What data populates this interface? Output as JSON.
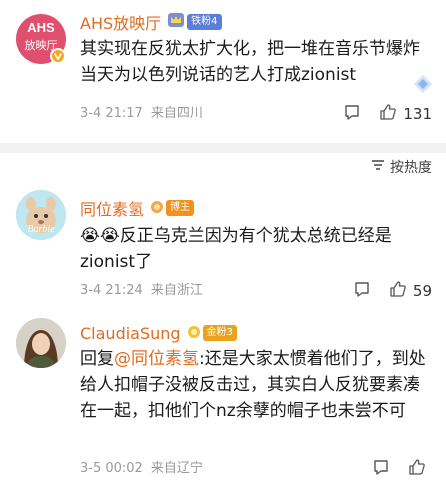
{
  "comments": [
    {
      "username": "AHS放映厅",
      "avatar_text": [
        "AHS",
        "放映厅"
      ],
      "fan_badge": "铁粉4",
      "text": "其实现在反犹太扩大化，把一堆在音乐节爆炸当天为以色列说话的艺人打成zionist",
      "date": "3-4 21:17",
      "location": "来自四川",
      "likes": "131",
      "colors": {
        "avatar_bg": "#e0506e",
        "badge_bg": "#5b7fd8"
      }
    },
    {
      "username": "同位素氢",
      "avatar_text": "Barbie",
      "fan_badge": "博主",
      "text_emoji": "😭😭",
      "text": "反正乌克兰因为有个犹太总统已经是zionist了",
      "date": "3-4 21:24",
      "location": "来自浙江",
      "likes": "59",
      "colors": {
        "badge_bg": "#f0931e"
      }
    },
    {
      "username": "ClaudiaSung",
      "fan_badge": "金粉3",
      "reply_prefix": "回复",
      "mention": "@同位素氢",
      "text": ":还是大家太惯着他们了，到处给人扣帽子没被反击过，其实白人反犹要素凑在一起，扣他们个nz余孽的帽子也未尝不可",
      "date": "3-5 00:02",
      "location": "来自辽宁",
      "likes": "",
      "colors": {
        "badge_bg": "#e8a320"
      }
    }
  ],
  "sort": {
    "label": "按热度"
  },
  "icons": [
    "comment-icon",
    "like-icon",
    "sort-icon",
    "crown-icon",
    "bronze-medal-icon",
    "gold-medal-icon",
    "verified-icon",
    "sticker-icon"
  ]
}
